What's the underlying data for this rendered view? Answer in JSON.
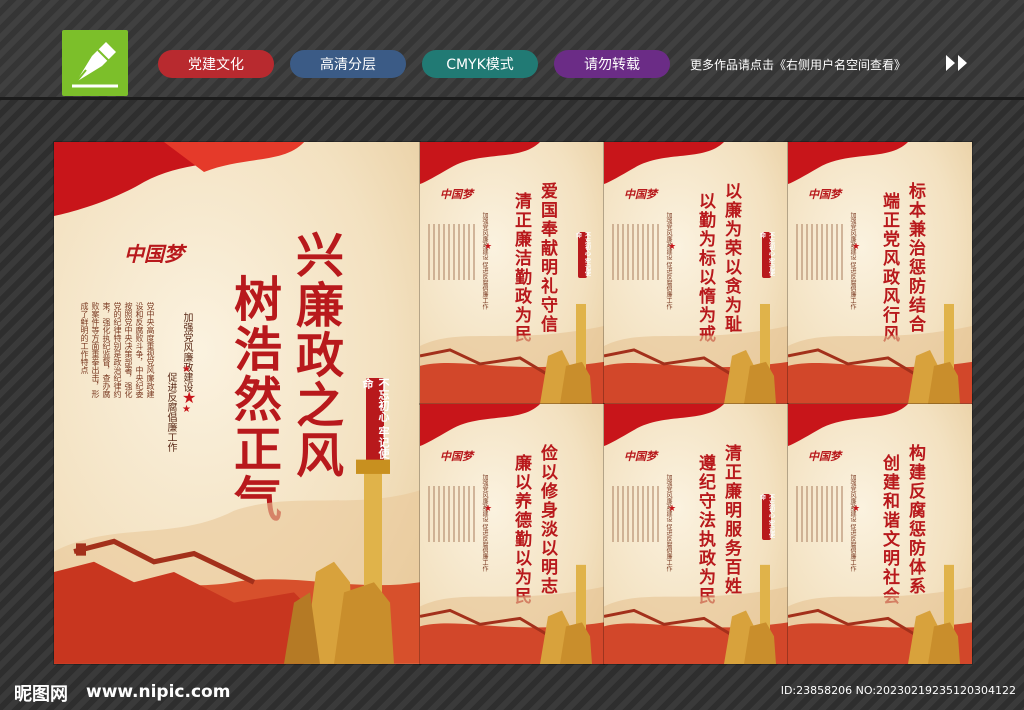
{
  "header": {
    "tags": [
      "党建文化",
      "高清分层",
      "CMYK模式",
      "请勿转载"
    ],
    "more_text": "更多作品请点击《右侧用户名空间查看》",
    "logo_icon": "pen-nib-icon",
    "arrow_icon": "double-chevron-right-icon"
  },
  "main_poster": {
    "title_line1": "兴廉政之风",
    "title_line2": "树浩然正气",
    "subtitle_line1": "加强党风廉政建设",
    "subtitle_line2": "促进反腐倡廉工作",
    "body_text": "党中央高度重视党风廉政建设和反腐败斗争，中央纪委按照党中央决策部署，强化党的纪律特别是政治纪律约束，强化执纪监督，查办腐败案件等方面重拳出击，形成了鲜明的工作特点",
    "seal_text": "不忘初心 牢记使命",
    "dream_text": "中国梦"
  },
  "small_posters": [
    {
      "line1": "爱国奉献明礼守信",
      "line2": "清正廉洁勤政为民"
    },
    {
      "line1": "以廉为荣以贪为耻",
      "line2": "以勤为标以惰为戒"
    },
    {
      "line1": "标本兼治惩防结合",
      "line2": "端正党风政风行风"
    },
    {
      "line1": "俭以修身淡以明志",
      "line2": "廉以养德勤以为民"
    },
    {
      "line1": "清正廉明服务百姓",
      "line2": "遵纪守法执政为民"
    },
    {
      "line1": "构建反腐惩防体系",
      "line2": "创建和谐文明社会"
    }
  ],
  "small_subtitle": "加强党风廉政建设 促进反腐倡廉工作",
  "small_seal": "不忘初心 牢记使命",
  "footer": {
    "site_name": "昵图网",
    "site_url": "www.nipic.com",
    "image_id": "ID:23858206 NO:20230219235120304122"
  },
  "colors": {
    "accent_red": "#b8191c",
    "tag_red": "#b82a2f",
    "tag_blue": "#3b5b86",
    "tag_teal": "#217a74",
    "tag_purple": "#6b2c86",
    "logo_green": "#7cbf2a"
  }
}
